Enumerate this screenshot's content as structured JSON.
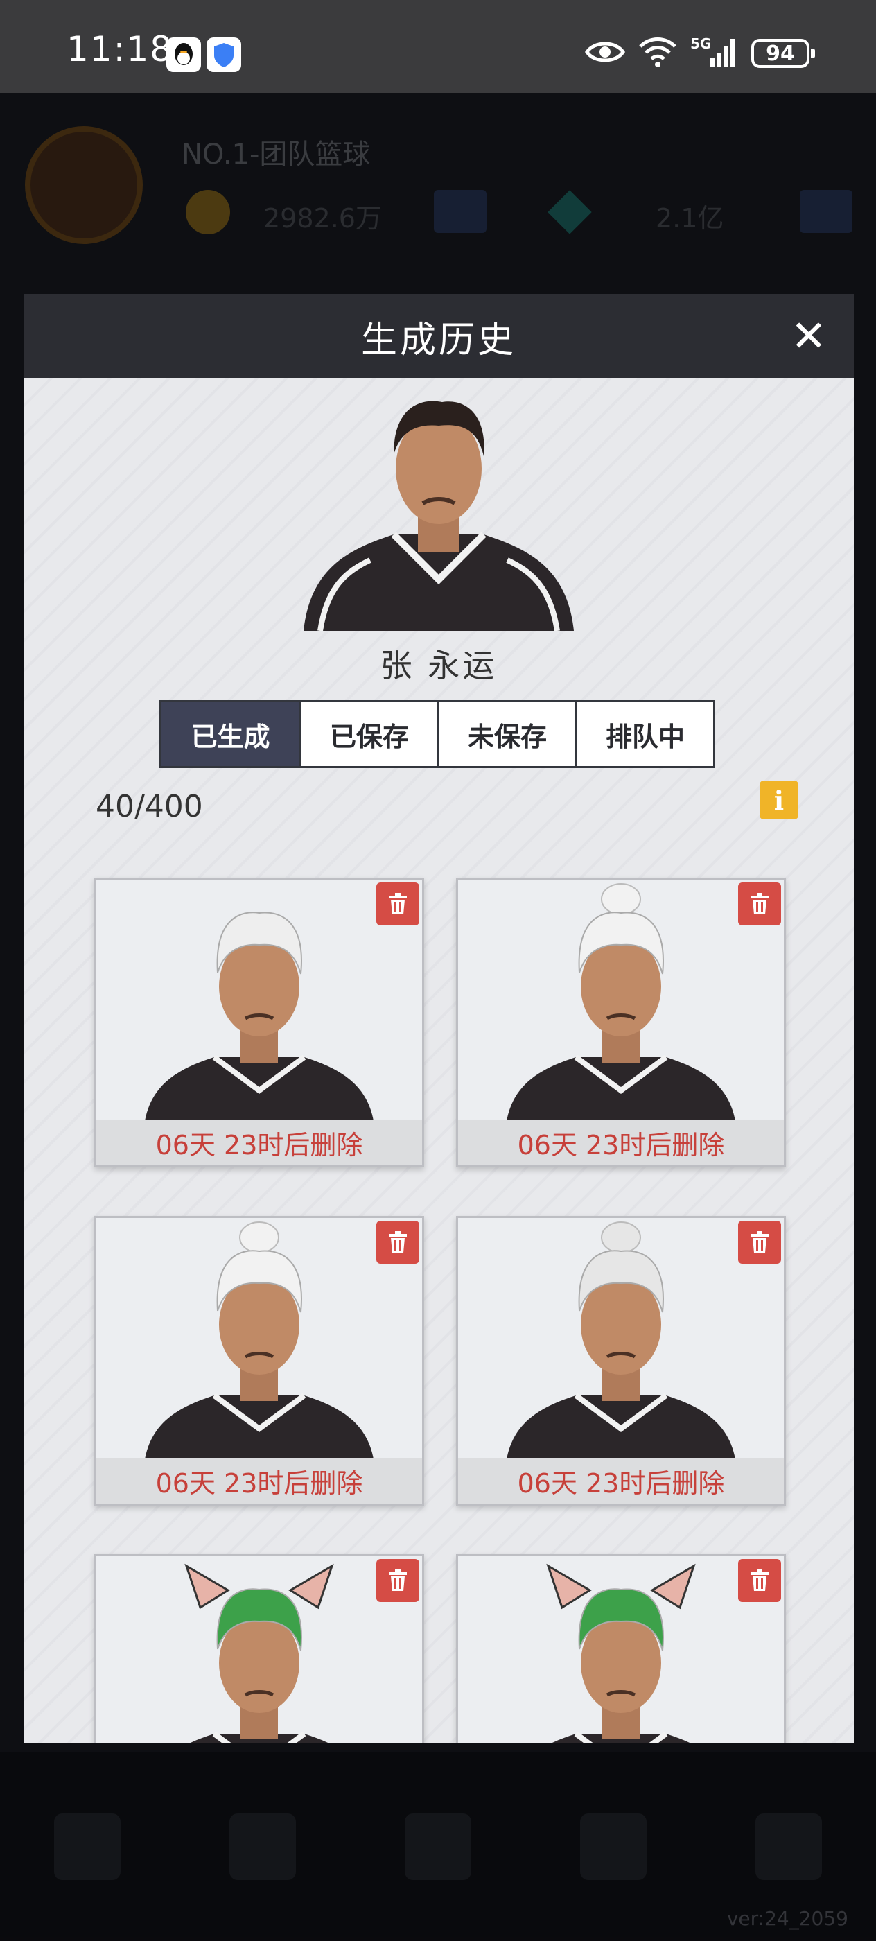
{
  "status_bar": {
    "time": "11:18",
    "icons": [
      "qq-icon",
      "shield-icon",
      "eye-icon",
      "wifi-icon",
      "signal-5g-icon"
    ],
    "battery": "94"
  },
  "background": {
    "team_name": "NO.1-团队篮球",
    "coins": "2982.6万",
    "gems": "2.1亿",
    "version": "ver:24_2059"
  },
  "modal": {
    "title": "生成历史",
    "close_icon": "close-icon",
    "player_name": "张 永运",
    "tabs": [
      "已生成",
      "已保存",
      "未保存",
      "排队中"
    ],
    "active_tab": 0,
    "count": "40/400",
    "info_label": "i",
    "cards": [
      {
        "caption": "06天 23时后删除",
        "hair": "white-swept"
      },
      {
        "caption": "06天 23时后删除",
        "hair": "white-bun"
      },
      {
        "caption": "06天 23时后删除",
        "hair": "white-bun"
      },
      {
        "caption": "06天 23时后删除",
        "hair": "white-long-bun"
      },
      {
        "caption": "",
        "hair": "green-cat-ears"
      },
      {
        "caption": "",
        "hair": "green-cat-ears"
      }
    ]
  },
  "colors": {
    "accent_tab": "#3e4257",
    "delete_red": "#d54c45",
    "caption_red": "#c7403a",
    "info_yellow": "#f0b428"
  }
}
